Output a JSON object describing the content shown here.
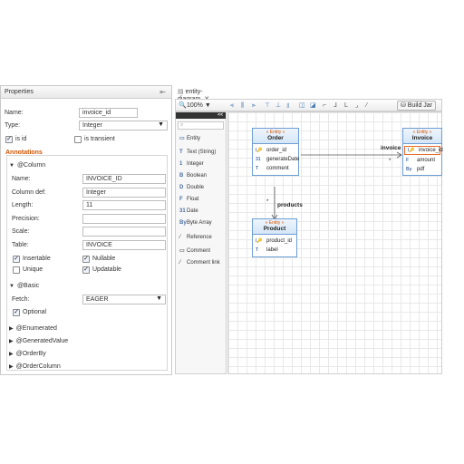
{
  "properties": {
    "title": "Properties",
    "name_label": "Name:",
    "name_value": "invoice_id",
    "type_label": "Type:",
    "type_value": "Integer",
    "is_id_label": "is id",
    "is_transient_label": "is transient",
    "annotations_label": "Annotations",
    "column": {
      "header": "@Column",
      "name_label": "Name:",
      "name_value": "INVOICE_ID",
      "coldef_label": "Column def:",
      "coldef_value": "Integer",
      "length_label": "Length:",
      "length_value": "11",
      "precision_label": "Precision:",
      "precision_value": "",
      "scale_label": "Scale:",
      "scale_value": "",
      "table_label": "Table:",
      "table_value": "INVOICE",
      "insertable_label": "Insertable",
      "nullable_label": "Nullable",
      "unique_label": "Unique",
      "updatable_label": "Updatable"
    },
    "basic": {
      "header": "@Basic",
      "fetch_label": "Fetch:",
      "fetch_value": "EAGER",
      "optional_label": "Optional"
    },
    "collapsed": [
      "@Enumerated",
      "@GeneratedValue",
      "@OrderBy",
      "@OrderColumn"
    ]
  },
  "diagram": {
    "tab_label": "entity-diagram",
    "zoom_label": "100%",
    "build_jar_label": "Build Jar",
    "palette_collapse": "<<",
    "palette_items": [
      "Entity",
      "Text (String)",
      "Integer",
      "Boolean",
      "Double",
      "Float",
      "Date",
      "Byte Array",
      "Reference",
      "Comment",
      "Comment link"
    ],
    "entities": {
      "order": {
        "stereotype": "« Entity »",
        "name": "Order",
        "attrs": [
          "order_id",
          "generateDate",
          "comment"
        ]
      },
      "invoice": {
        "stereotype": "« Entity »",
        "name": "Invoice",
        "attrs": [
          "invoice_id",
          "amount",
          "pdf"
        ]
      },
      "product": {
        "stereotype": "« Entity »",
        "name": "Product",
        "attrs": [
          "product_id",
          "label"
        ]
      }
    },
    "connectors": {
      "invoice_label": "invoice",
      "invoice_mult": "*",
      "products_label": "products",
      "products_mult": "*"
    }
  },
  "colors": {
    "accent": "#d35400",
    "entity_border": "#6d9ed4",
    "selection": "#e56b2c"
  }
}
